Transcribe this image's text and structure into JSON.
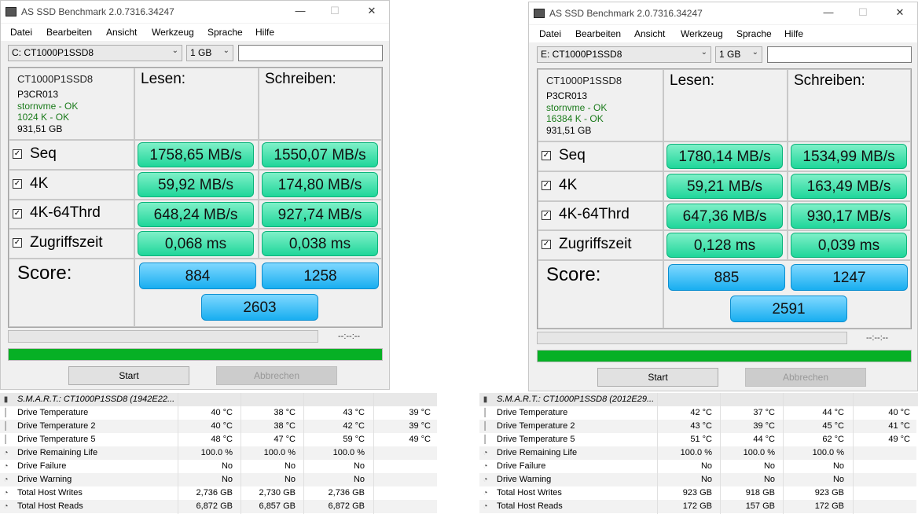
{
  "windows": [
    {
      "title": "AS SSD Benchmark 2.0.7316.34247",
      "menu": [
        "Datei",
        "Bearbeiten",
        "Ansicht",
        "Werkzeug",
        "Sprache",
        "Hilfe"
      ],
      "drive_select": "C: CT1000P1SSD8",
      "size_select": "1 GB",
      "device": {
        "name": "CT1000P1SSD8",
        "firmware": "P3CR013",
        "driver": "stornvme - OK",
        "align": "1024 K - OK",
        "capacity": "931,51 GB"
      },
      "header_read": "Lesen:",
      "header_write": "Schreiben:",
      "rows": [
        {
          "label": "Seq",
          "read": "1758,65 MB/s",
          "write": "1550,07 MB/s"
        },
        {
          "label": "4K",
          "read": "59,92 MB/s",
          "write": "174,80 MB/s"
        },
        {
          "label": "4K-64Thrd",
          "read": "648,24 MB/s",
          "write": "927,74 MB/s"
        },
        {
          "label": "Zugriffszeit",
          "read": "0,068 ms",
          "write": "0,038 ms"
        }
      ],
      "score_label": "Score:",
      "score_read": "884",
      "score_write": "1258",
      "score_total": "2603",
      "time_display": "--:--:--",
      "start_label": "Start",
      "cancel_label": "Abbrechen"
    },
    {
      "title": "AS SSD Benchmark 2.0.7316.34247",
      "menu": [
        "Datei",
        "Bearbeiten",
        "Ansicht",
        "Werkzeug",
        "Sprache",
        "Hilfe"
      ],
      "drive_select": "E: CT1000P1SSD8",
      "size_select": "1 GB",
      "device": {
        "name": "CT1000P1SSD8",
        "firmware": "P3CR013",
        "driver": "stornvme - OK",
        "align": "16384 K - OK",
        "capacity": "931,51 GB"
      },
      "header_read": "Lesen:",
      "header_write": "Schreiben:",
      "rows": [
        {
          "label": "Seq",
          "read": "1780,14 MB/s",
          "write": "1534,99 MB/s"
        },
        {
          "label": "4K",
          "read": "59,21 MB/s",
          "write": "163,49 MB/s"
        },
        {
          "label": "4K-64Thrd",
          "read": "647,36 MB/s",
          "write": "930,17 MB/s"
        },
        {
          "label": "Zugriffszeit",
          "read": "0,128 ms",
          "write": "0,039 ms"
        }
      ],
      "score_label": "Score:",
      "score_read": "885",
      "score_write": "1247",
      "score_total": "2591",
      "time_display": "--:--:--",
      "start_label": "Start",
      "cancel_label": "Abbrechen"
    }
  ],
  "smart_tables": [
    {
      "title": "S.M.A.R.T.: CT1000P1SSD8 (1942E22...",
      "rows": [
        {
          "icon": "thermometer-icon",
          "name": "Drive Temperature",
          "v": [
            "40 °C",
            "38 °C",
            "43 °C",
            "39 °C"
          ]
        },
        {
          "icon": "thermometer-icon",
          "name": "Drive Temperature 2",
          "v": [
            "40 °C",
            "38 °C",
            "42 °C",
            "39 °C"
          ]
        },
        {
          "icon": "thermometer-icon",
          "name": "Drive Temperature 5",
          "v": [
            "48 °C",
            "47 °C",
            "59 °C",
            "49 °C"
          ]
        },
        {
          "icon": "gauge-icon",
          "name": "Drive Remaining Life",
          "v": [
            "100.0 %",
            "100.0 %",
            "100.0 %",
            ""
          ]
        },
        {
          "icon": "gauge-icon",
          "name": "Drive Failure",
          "v": [
            "No",
            "No",
            "No",
            ""
          ]
        },
        {
          "icon": "gauge-icon",
          "name": "Drive Warning",
          "v": [
            "No",
            "No",
            "No",
            ""
          ]
        },
        {
          "icon": "gauge-icon",
          "name": "Total Host Writes",
          "v": [
            "2,736 GB",
            "2,730 GB",
            "2,736 GB",
            ""
          ]
        },
        {
          "icon": "gauge-icon",
          "name": "Total Host Reads",
          "v": [
            "6,872 GB",
            "6,857 GB",
            "6,872 GB",
            ""
          ]
        }
      ]
    },
    {
      "title": "S.M.A.R.T.: CT1000P1SSD8 (2012E29...",
      "rows": [
        {
          "icon": "thermometer-icon",
          "name": "Drive Temperature",
          "v": [
            "42 °C",
            "37 °C",
            "44 °C",
            "40 °C"
          ]
        },
        {
          "icon": "thermometer-icon",
          "name": "Drive Temperature 2",
          "v": [
            "43 °C",
            "39 °C",
            "45 °C",
            "41 °C"
          ]
        },
        {
          "icon": "thermometer-icon",
          "name": "Drive Temperature 5",
          "v": [
            "51 °C",
            "44 °C",
            "62 °C",
            "49 °C"
          ]
        },
        {
          "icon": "gauge-icon",
          "name": "Drive Remaining Life",
          "v": [
            "100.0 %",
            "100.0 %",
            "100.0 %",
            ""
          ]
        },
        {
          "icon": "gauge-icon",
          "name": "Drive Failure",
          "v": [
            "No",
            "No",
            "No",
            ""
          ]
        },
        {
          "icon": "gauge-icon",
          "name": "Drive Warning",
          "v": [
            "No",
            "No",
            "No",
            ""
          ]
        },
        {
          "icon": "gauge-icon",
          "name": "Total Host Writes",
          "v": [
            "923 GB",
            "918 GB",
            "923 GB",
            ""
          ]
        },
        {
          "icon": "gauge-icon",
          "name": "Total Host Reads",
          "v": [
            "172 GB",
            "157 GB",
            "172 GB",
            ""
          ]
        }
      ]
    }
  ],
  "colors": {
    "result_green": "#1fd69a",
    "score_blue": "#18aef0",
    "progress_green": "#06b025",
    "status_ok": "#1a7a1a"
  }
}
